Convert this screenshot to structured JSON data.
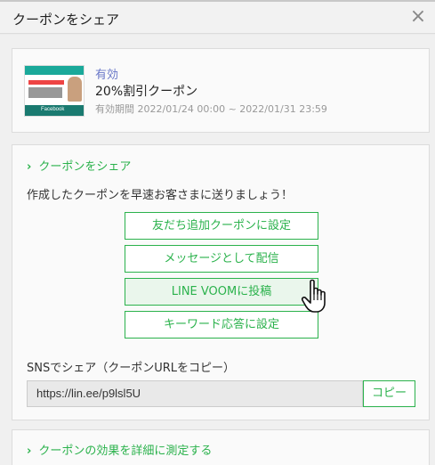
{
  "modal": {
    "title": "クーポンをシェア",
    "close_icon": "close-icon"
  },
  "coupon": {
    "status": "有効",
    "name": "20%割引クーポン",
    "validity": "有効期間 2022/01/24 00:00 ~ 2022/01/31 23:59",
    "thumbnail_label": "Facebook"
  },
  "share": {
    "section_label": "クーポンをシェア",
    "description": "作成したクーポンを早速お客さまに送りましょう！",
    "buttons": [
      "友だち追加クーポンに設定",
      "メッセージとして配信",
      "LINE VOOMに投稿",
      "キーワード応答に設定"
    ],
    "sns_label": "SNSでシェア（クーポンURLをコピー）",
    "url_value": "https://lin.ee/p9lsl5U",
    "copy_label": "コピー"
  },
  "measure": {
    "section_label": "クーポンの効果を詳細に測定する"
  },
  "colors": {
    "accent": "#2bb24c",
    "status": "#6a78c8"
  }
}
